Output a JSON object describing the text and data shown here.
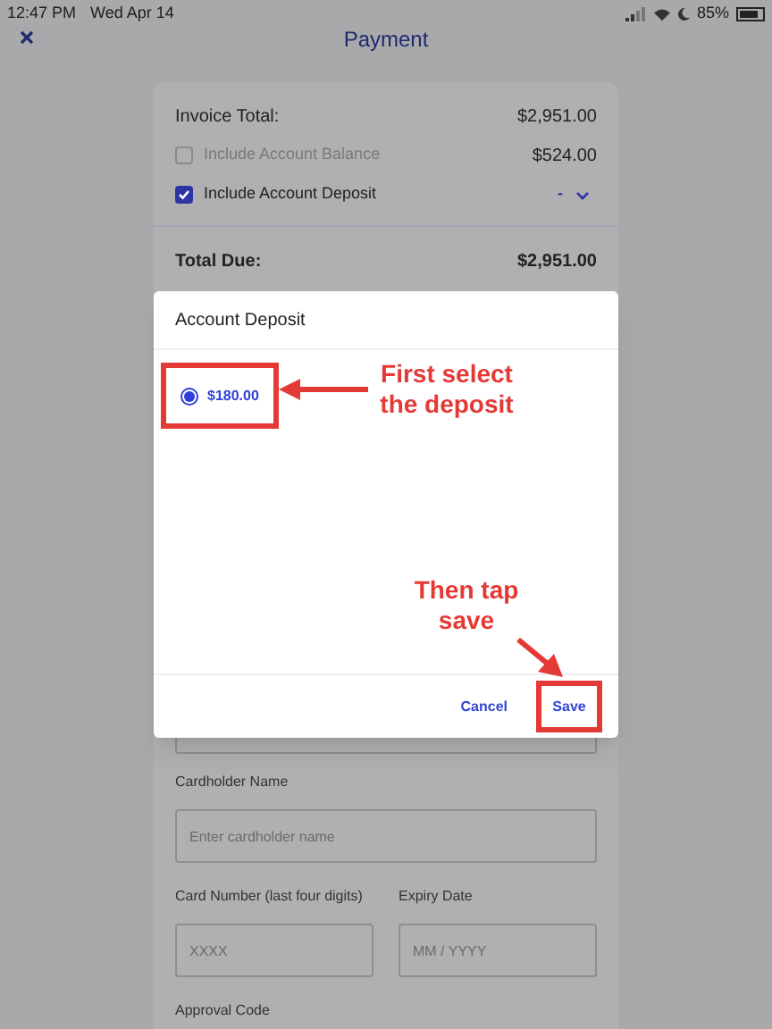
{
  "status_bar": {
    "time": "12:47 PM",
    "date": "Wed Apr 14",
    "battery": "85%"
  },
  "header": {
    "title": "Payment"
  },
  "summary": {
    "invoice_total": {
      "label": "Invoice Total:",
      "value": "$2,951.00"
    },
    "options": [
      {
        "label": "Include Account Balance",
        "value": "$524.00",
        "checked": false
      },
      {
        "label": "Include Account Deposit",
        "value": "-",
        "checked": true
      }
    ],
    "total_due": {
      "label": "Total Due:",
      "value": "$2,951.00"
    }
  },
  "form": {
    "cardholder": {
      "label": "Cardholder Name",
      "placeholder": "Enter cardholder name"
    },
    "card_number": {
      "label": "Card Number (last four digits)",
      "placeholder": "XXXX"
    },
    "expiry": {
      "label": "Expiry Date",
      "placeholder": "MM / YYYY"
    },
    "approval_code": {
      "label": "Approval Code"
    }
  },
  "modal": {
    "title": "Account Deposit",
    "options": [
      {
        "label": "$180.00",
        "selected": true
      }
    ],
    "buttons": [
      {
        "label": "Cancel"
      },
      {
        "label": "Save"
      }
    ]
  },
  "annotations": [
    {
      "text": "First select the deposit"
    },
    {
      "text": "Then tap save"
    }
  ]
}
